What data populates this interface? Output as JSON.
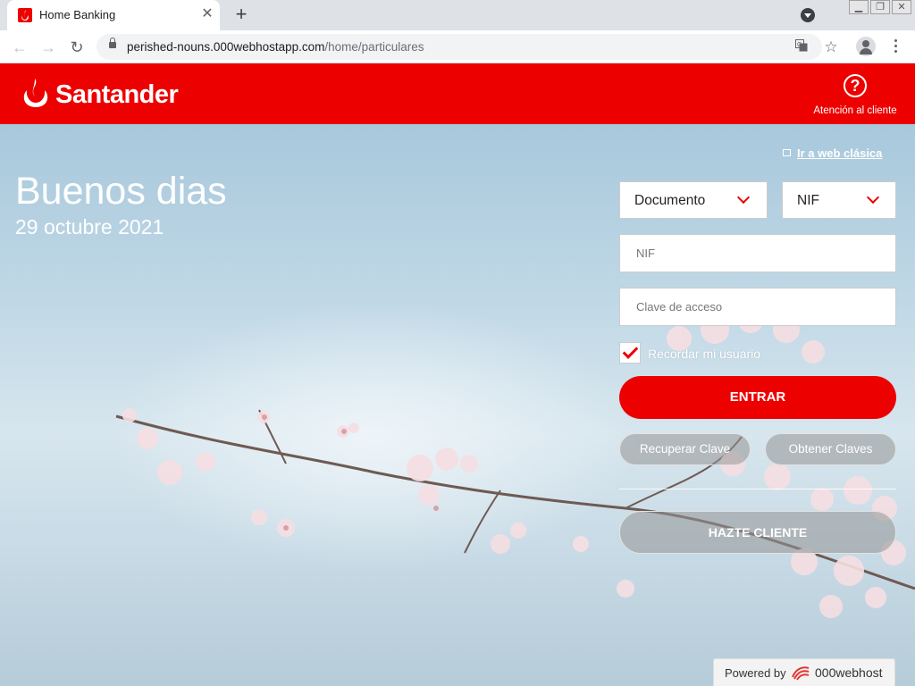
{
  "browser": {
    "tab": {
      "title": "Home Banking"
    },
    "url": {
      "host": "perished-nouns.000webhostapp.com",
      "path": "/home/particulares"
    }
  },
  "header": {
    "brand": "Santander",
    "help_label": "Atención al cliente"
  },
  "hero": {
    "greeting": "Buenos dias",
    "date": "29 octubre 2021"
  },
  "login": {
    "classic_link": "Ir a web clásica",
    "document_select": "Documento",
    "type_select": "NIF",
    "user_placeholder": "NIF",
    "password_placeholder": "Clave de acceso",
    "remember_label": "Recordar mi usuario",
    "remember_checked": true,
    "submit": "ENTRAR",
    "recover": "Recuperar Clave",
    "obtain": "Obtener Claves",
    "become_client": "HAZTE CLIENTE"
  },
  "footer": {
    "powered_by": "Powered by",
    "host_brand": "000webhost"
  },
  "colors": {
    "brand_red": "#ec0000"
  },
  "icons": [
    "santander-flame-icon",
    "help-icon",
    "lock-icon",
    "translate-icon",
    "star-icon",
    "profile-icon",
    "menu-icon",
    "chevron-down-icon",
    "checkmark-icon",
    "external-link-icon"
  ]
}
